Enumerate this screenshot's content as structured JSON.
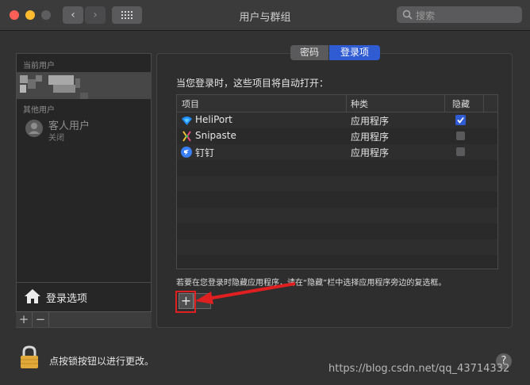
{
  "window": {
    "title": "用户与群组",
    "search_placeholder": "搜索",
    "back_glyph": "‹",
    "forward_glyph": "›"
  },
  "sidebar": {
    "current_users_label": "当前用户",
    "other_users_label": "其他用户",
    "guest_name": "客人用户",
    "guest_status": "关闭",
    "login_options_label": "登录选项",
    "add_glyph": "+",
    "remove_glyph": "−"
  },
  "tabs": [
    {
      "label": "密码",
      "selected": false
    },
    {
      "label": "登录项",
      "selected": true
    }
  ],
  "main": {
    "heading": "当您登录时，这些项目将自动打开：",
    "columns": {
      "item": "项目",
      "kind": "种类",
      "hide": "隐藏"
    },
    "rows": [
      {
        "name": "HeliPort",
        "kind": "应用程序",
        "hidden": true,
        "icon": "wifi-icon"
      },
      {
        "name": "Snipaste",
        "kind": "应用程序",
        "hidden": false,
        "icon": "snipaste-icon"
      },
      {
        "name": "钉钉",
        "kind": "应用程序",
        "hidden": false,
        "icon": "dingtalk-icon"
      }
    ],
    "hint": "若要在您登录时隐藏应用程序，请在“隐藏”栏中选择应用程序旁边的复选框。",
    "add_glyph": "+"
  },
  "footer": {
    "lock_text": "点按锁按钮以进行更改。",
    "help_glyph": "?",
    "watermark": "https://blog.csdn.net/qq_43714332"
  },
  "colors": {
    "accent": "#2f5bd3",
    "annotation_red": "#e02020",
    "lock_gold": "#e0a93a"
  }
}
